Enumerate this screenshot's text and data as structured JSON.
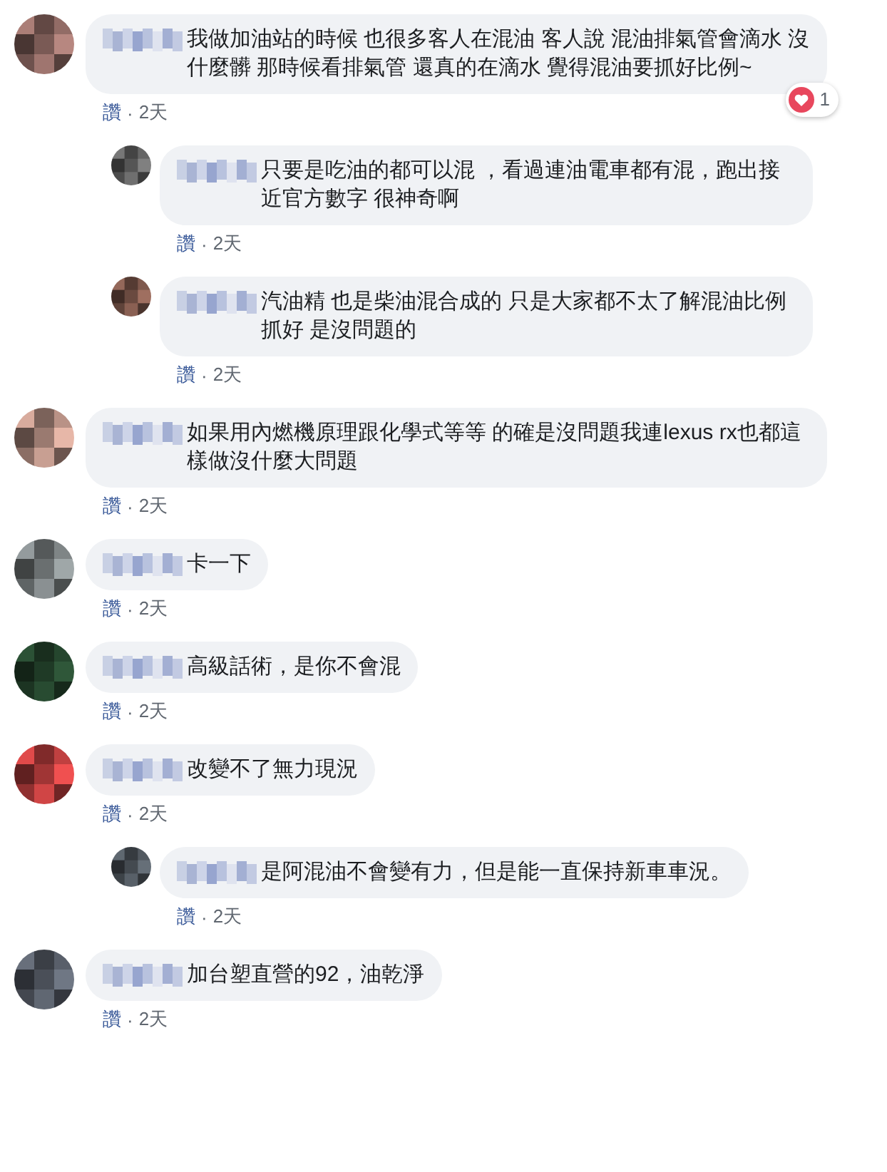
{
  "comments": [
    {
      "color": "#7a5a55",
      "text": "我做加油站的時候 也很多客人在混油 客人說 混油排氣管會滴水 沒什麼髒 那時候看排氣管 還真的在滴水 覺得混油要抓好比例~",
      "reaction_count": "1",
      "like": "讚",
      "separator": "·",
      "time": "2天",
      "replies": [
        {
          "color": "#555555",
          "text": "只要是吃油的都可以混 ，看過連油電車都有混，跑出接近官方數字 很神奇啊",
          "like": "讚",
          "separator": "·",
          "time": "2天"
        },
        {
          "color": "#6a4a40",
          "text": "汽油精 也是柴油混合成的 只是大家都不太了解混油比例抓好 是沒問題的",
          "like": "讚",
          "separator": "·",
          "time": "2天"
        }
      ]
    },
    {
      "color": "#9a7a70",
      "text": "如果用內燃機原理跟化學式等等 的確是沒問題我連lexus rx也都這樣做沒什麼大問題",
      "like": "讚",
      "separator": "·",
      "time": "2天"
    },
    {
      "color": "#6a6f70",
      "text": "卡一下",
      "like": "讚",
      "separator": "·",
      "time": "2天"
    },
    {
      "color": "#1f3a26",
      "text": "高級話術，是你不會混",
      "like": "讚",
      "separator": "·",
      "time": "2天"
    },
    {
      "color": "#a03535",
      "text": "改變不了無力現況",
      "like": "讚",
      "separator": "·",
      "time": "2天",
      "replies": [
        {
          "color": "#444a50",
          "text": "是阿混油不會變有力，但是能一直保持新車車況。",
          "like": "讚",
          "separator": "·",
          "time": "2天"
        }
      ]
    },
    {
      "color": "#4a4f58",
      "text": "加台塑直營的92，油乾淨",
      "like": "讚",
      "separator": "·",
      "time": "2天"
    }
  ]
}
